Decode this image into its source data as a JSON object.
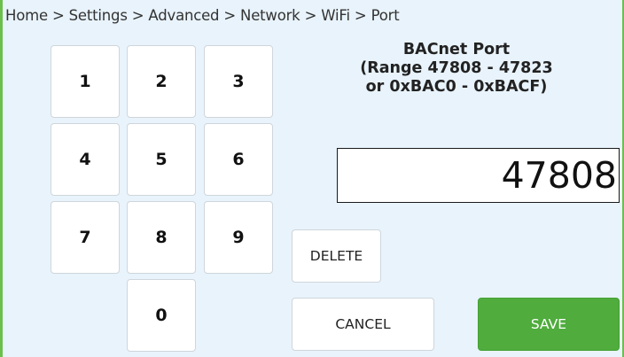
{
  "breadcrumb": "Home > Settings > Advanced > Network > WiFi > Port",
  "title": {
    "line1": "BACnet Port",
    "line2": "(Range 47808 - 47823",
    "line3": "or 0xBAC0 - 0xBACF)"
  },
  "input": {
    "value": "47808"
  },
  "keypad": {
    "k1": "1",
    "k2": "2",
    "k3": "3",
    "k4": "4",
    "k5": "5",
    "k6": "6",
    "k7": "7",
    "k8": "8",
    "k9": "9",
    "k0": "0"
  },
  "buttons": {
    "delete": "DELETE",
    "cancel": "CANCEL",
    "save": "SAVE"
  },
  "colors": {
    "background": "#e8f3fb",
    "accent_green": "#4fac3d",
    "frame_green": "#6cbf4a"
  }
}
